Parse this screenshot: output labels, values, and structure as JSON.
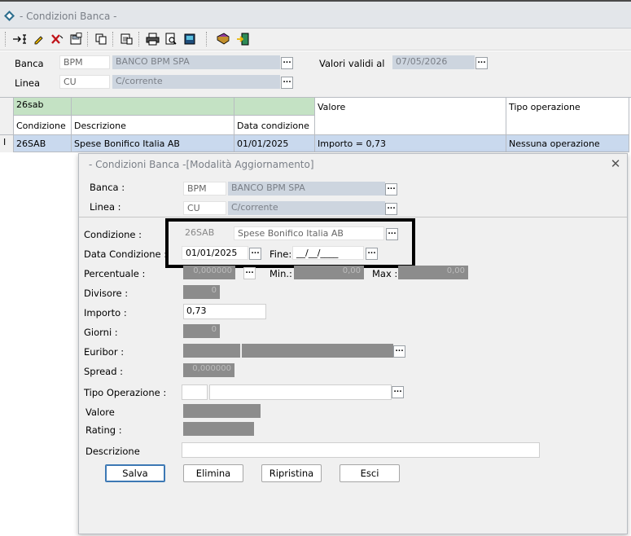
{
  "window": {
    "title": "- Condizioni Banca -"
  },
  "toolbar": {
    "buttons": [
      {
        "icon": "insert-icon"
      },
      {
        "icon": "edit-pencil-icon"
      },
      {
        "icon": "delete-x-icon"
      },
      {
        "icon": "save-icon"
      },
      {
        "icon": "copy-icon"
      },
      {
        "icon": "paste-icon"
      },
      {
        "icon": "print-icon"
      },
      {
        "icon": "print-preview-icon"
      },
      {
        "icon": "export-icon"
      },
      {
        "icon": "book-icon"
      },
      {
        "icon": "exit-door-icon"
      }
    ]
  },
  "header": {
    "banca_label": "Banca",
    "banca_code": "BPM",
    "banca_name": "BANCO BPM SPA",
    "valori_label": "Valori validi al",
    "valori_date": "07/05/2026",
    "linea_label": "Linea",
    "linea_code": "CU",
    "linea_name": "C/corrente",
    "ellipsis": "..."
  },
  "grid": {
    "filter_value": "26sab",
    "columns": [
      "Condizione",
      "Descrizione",
      "Data condizione",
      "Valore",
      "Tipo operazione"
    ],
    "row_indicator": "I",
    "rows": [
      {
        "condizione": "26SAB",
        "descrizione": "Spese Bonifico Italia AB",
        "data": "01/01/2025",
        "valore": "Importo = 0,73",
        "tipo": "Nessuna operazione"
      }
    ]
  },
  "dialog": {
    "title": "- Condizioni Banca -[Modalità Aggiornamento]",
    "close": "✕",
    "banca_label": "Banca :",
    "banca_code": "BPM",
    "banca_name": "BANCO BPM SPA",
    "linea_label": "Linea :",
    "linea_code": "CU",
    "linea_name": "C/corrente",
    "condizione_label": "Condizione :",
    "condizione_code": "26SAB",
    "condizione_name": "Spese Bonifico Italia AB",
    "data_label": "Data Condizione :",
    "data_value": "01/01/2025",
    "fine_label": "Fine:",
    "fine_value": "__/__/____",
    "percentuale_label": "Percentuale :",
    "percentuale_value": "0,000000",
    "min_label": "Min.:",
    "min_value": "0,00",
    "max_label": "Max :",
    "max_value": "0,00",
    "divisore_label": "Divisore :",
    "divisore_value": "0",
    "importo_label": "Importo :",
    "importo_value": "0,73",
    "giorni_label": "Giorni :",
    "giorni_value": "0",
    "euribor_label": "Euribor :",
    "spread_label": "Spread :",
    "spread_value": "0,000000",
    "tipo_label": "Tipo Operazione :",
    "valore_label": "Valore",
    "rating_label": "Rating :",
    "descrizione_label": "Descrizione",
    "descrizione_value": "",
    "buttons": {
      "salva": "Salva",
      "elimina": "Elimina",
      "ripristina": "Ripristina",
      "esci": "Esci"
    },
    "ellipsis": "..."
  }
}
